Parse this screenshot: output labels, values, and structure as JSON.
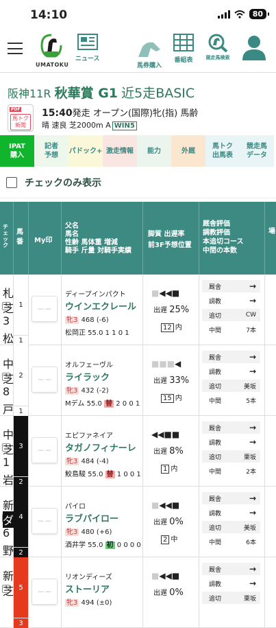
{
  "status": {
    "time": "14:10",
    "battery": "80"
  },
  "nav": {
    "logo_label": "UMATOKU",
    "news_label": "ニュース",
    "bet_label": "馬券購入",
    "card_label": "番組表",
    "search_label": "競走馬検索"
  },
  "race": {
    "venue_num": "阪神11R",
    "name_main": "秋華賞 G1",
    "name_sub": "近5走BASIC",
    "start_time": "15:40",
    "start_suffix": "発走",
    "conditions": "オープン(国際)牝(指) 馬齢",
    "weather": "晴 速良 芝2000m A",
    "win5": "WIN5",
    "pdf_badge": "PDF",
    "pdf_text": "馬トク新聞"
  },
  "tabs": [
    "IPAT購入",
    "記者予想",
    "パドック+",
    "激走情報",
    "能力",
    "外厩",
    "馬トク出馬表",
    "競走馬データ"
  ],
  "filter": {
    "label": "チェックのみ表示"
  },
  "header": {
    "check": "チェック",
    "umaban": "馬番",
    "my": "My印",
    "col1": [
      "父名",
      "馬名",
      "性齢 馬体重 増減",
      "騎手 斤量 対騎手実績"
    ],
    "col2": [
      "脚質 出遅率",
      "前3F予想位置"
    ],
    "col3": [
      "厩舎評価",
      "調教評価",
      "本追切コース",
      "中間の本数"
    ],
    "col4": "場"
  },
  "labels": {
    "stable": "厩舎",
    "train": "調教",
    "last": "追切",
    "mid": "中間",
    "late": "出遅"
  },
  "horses": [
    {
      "gate": "1",
      "num": "1",
      "sire": "ディープインパクト",
      "name": "ウインエクレール",
      "sex": "牝3",
      "weight": "468 (-6)",
      "jockey": "松岡正 55.0",
      "tag": "",
      "tagtype": "",
      "record": "1 1 0 1",
      "marks": "■◀◀■",
      "late": "25%",
      "pos_num": "12",
      "pos": "内",
      "course": "CW",
      "mid": "7本",
      "cut1": "札",
      "cut2": "芝",
      "cut3": "3",
      "cut4": "松"
    },
    {
      "gate": "1",
      "num": "2",
      "sire": "オルフェーヴル",
      "name": "ライラック",
      "sex": "牝3",
      "weight": "432 (-2)",
      "jockey": "Mデム 55.0",
      "tag": "替",
      "tagtype": "chg",
      "record": "2 0 0 1",
      "marks": "■■■◀",
      "late": "33%",
      "pos_num": "15",
      "pos": "内",
      "course": "美坂",
      "mid": "5本",
      "cut1": "中",
      "cut2": "芝",
      "cut3": "8",
      "cut4": "戸"
    },
    {
      "gate": "2",
      "num": "3",
      "sire": "エピファネイア",
      "name": "タガノフィナーレ",
      "sex": "牝3",
      "weight": "484 (-4)",
      "jockey": "鮫島駿 55.0",
      "tag": "替",
      "tagtype": "chg",
      "record": "1 0 0 1",
      "marks": "◀◀■■",
      "late": "8%",
      "pos_num": "1",
      "pos": "内",
      "course": "栗坂",
      "mid": "2本",
      "cut1": "中",
      "cut2": "芝",
      "cut3": "1",
      "cut4": "岩"
    },
    {
      "gate": "2",
      "num": "4",
      "sire": "パイロ",
      "name": "ラブパイロー",
      "sex": "牝3",
      "weight": "480 (+6)",
      "jockey": "酒井学 55.0",
      "tag": "初",
      "tagtype": "first",
      "record": "0 0 0 0",
      "marks": "■◀◀■",
      "late": "0%",
      "pos_num": "2",
      "pos": "中",
      "course": "美坂",
      "mid": "6本",
      "cut1": "新",
      "cut2": "ダ",
      "cut3": "6",
      "cut4": "野"
    },
    {
      "gate": "3",
      "num": "5",
      "sire": "リオンディーズ",
      "name": "ストーリア",
      "sex": "牝3",
      "weight": "494 (±0)",
      "jockey": "",
      "tag": "",
      "tagtype": "",
      "record": "",
      "marks": "■◀◀■",
      "late": "0%",
      "pos_num": "",
      "pos": "",
      "course": "栗坂",
      "mid": "",
      "cut1": "新",
      "cut2": "芝",
      "cut3": "",
      "cut4": ""
    }
  ],
  "colors": {
    "accent": "#2b7a5b",
    "header": "#3d8a82",
    "ipat": "#11b52d",
    "gate1": "#ffffff",
    "gate2": "#111111",
    "gate3": "#e53a1e"
  }
}
